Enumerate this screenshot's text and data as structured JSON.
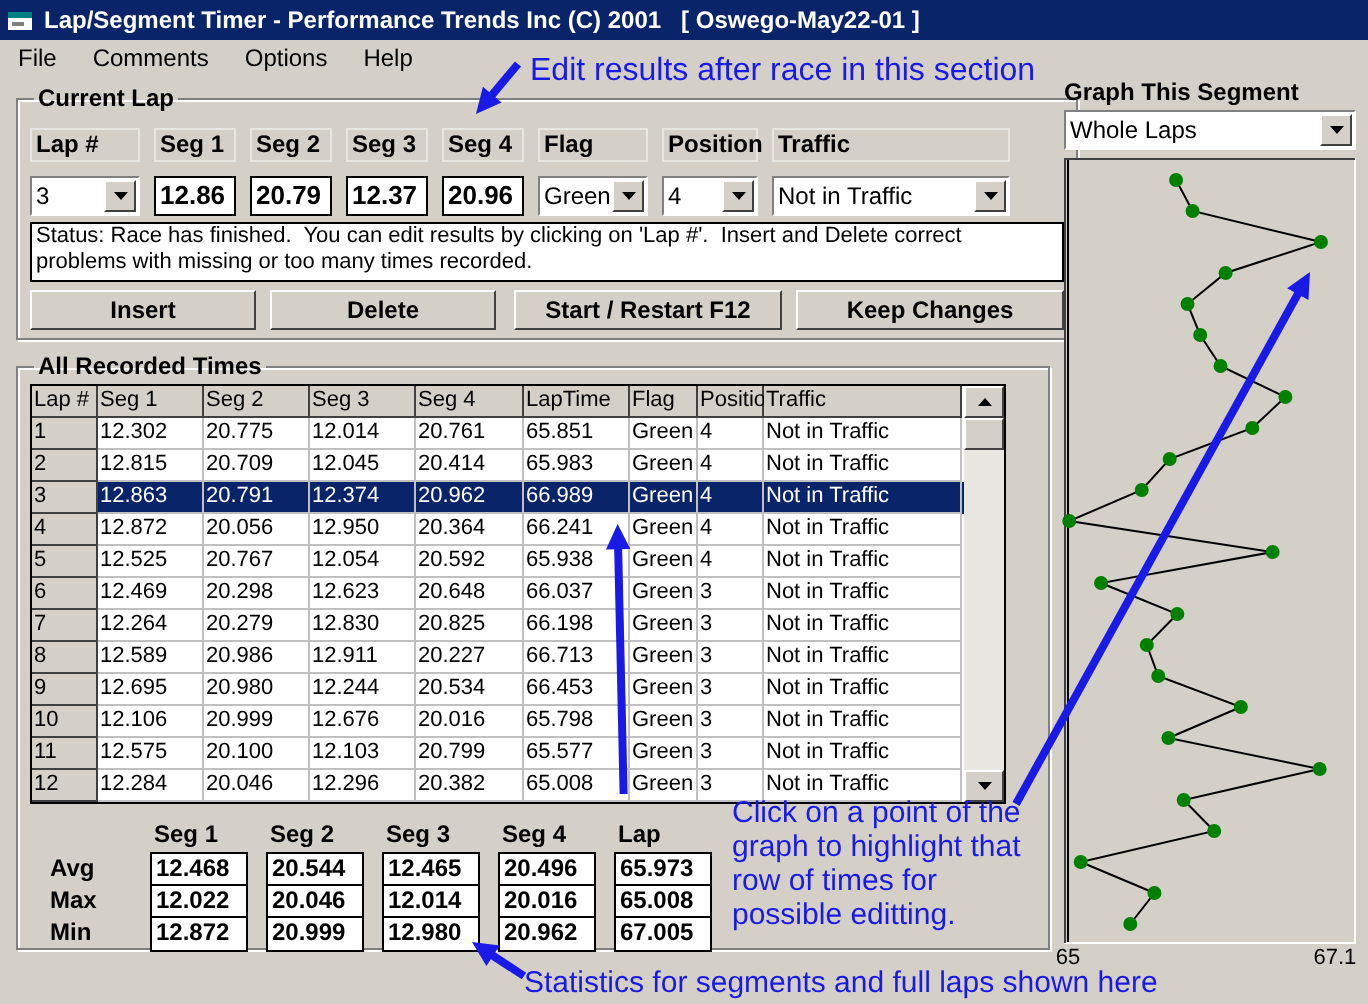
{
  "window": {
    "title": "Lap/Segment Timer - Performance Trends Inc (C) 2001   [ Oswego-May22-01 ]"
  },
  "menu": [
    "File",
    "Comments",
    "Options",
    "Help"
  ],
  "current_lap": {
    "title": "Current Lap",
    "fields": [
      {
        "kind": "dropdown",
        "label": "Lap #",
        "value": "3"
      },
      {
        "kind": "text",
        "label": "Seg 1",
        "value": "12.86"
      },
      {
        "kind": "text",
        "label": "Seg 2",
        "value": "20.79"
      },
      {
        "kind": "text",
        "label": "Seg 3",
        "value": "12.37"
      },
      {
        "kind": "text",
        "label": "Seg 4",
        "value": "20.96"
      },
      {
        "kind": "dropdown",
        "label": "Flag",
        "value": "Green"
      },
      {
        "kind": "dropdown",
        "label": "Position",
        "value": "4"
      },
      {
        "kind": "dropdown",
        "label": "Traffic",
        "value": "Not in Traffic"
      }
    ],
    "status": "Status: Race has finished.  You can edit results by clicking on 'Lap #'.  Insert and Delete correct problems with missing or too many times recorded.",
    "buttons": [
      "Insert",
      "Delete",
      "Start / Restart F12",
      "Keep Changes"
    ]
  },
  "recorded": {
    "title": "All Recorded Times",
    "columns": [
      "Lap #",
      "Seg 1",
      "Seg 2",
      "Seg 3",
      "Seg 4",
      "LapTime",
      "Flag",
      "Positio",
      "Traffic"
    ],
    "rows": [
      {
        "selected": false,
        "cells": [
          "1",
          "12.302",
          "20.775",
          "12.014",
          "20.761",
          "65.851",
          "Green",
          "4",
          "Not in Traffic"
        ]
      },
      {
        "selected": false,
        "cells": [
          "2",
          "12.815",
          "20.709",
          "12.045",
          "20.414",
          "65.983",
          "Green",
          "4",
          "Not in Traffic"
        ]
      },
      {
        "selected": true,
        "cells": [
          "3",
          "12.863",
          "20.791",
          "12.374",
          "20.962",
          "66.989",
          "Green",
          "4",
          "Not in Traffic"
        ]
      },
      {
        "selected": false,
        "cells": [
          "4",
          "12.872",
          "20.056",
          "12.950",
          "20.364",
          "66.241",
          "Green",
          "4",
          "Not in Traffic"
        ]
      },
      {
        "selected": false,
        "cells": [
          "5",
          "12.525",
          "20.767",
          "12.054",
          "20.592",
          "65.938",
          "Green",
          "4",
          "Not in Traffic"
        ]
      },
      {
        "selected": false,
        "cells": [
          "6",
          "12.469",
          "20.298",
          "12.623",
          "20.648",
          "66.037",
          "Green",
          "3",
          "Not in Traffic"
        ]
      },
      {
        "selected": false,
        "cells": [
          "7",
          "12.264",
          "20.279",
          "12.830",
          "20.825",
          "66.198",
          "Green",
          "3",
          "Not in Traffic"
        ]
      },
      {
        "selected": false,
        "cells": [
          "8",
          "12.589",
          "20.986",
          "12.911",
          "20.227",
          "66.713",
          "Green",
          "3",
          "Not in Traffic"
        ]
      },
      {
        "selected": false,
        "cells": [
          "9",
          "12.695",
          "20.980",
          "12.244",
          "20.534",
          "66.453",
          "Green",
          "3",
          "Not in Traffic"
        ]
      },
      {
        "selected": false,
        "cells": [
          "10",
          "12.106",
          "20.999",
          "12.676",
          "20.016",
          "65.798",
          "Green",
          "3",
          "Not in Traffic"
        ]
      },
      {
        "selected": false,
        "cells": [
          "11",
          "12.575",
          "20.100",
          "12.103",
          "20.799",
          "65.577",
          "Green",
          "3",
          "Not in Traffic"
        ]
      },
      {
        "selected": false,
        "cells": [
          "12",
          "12.284",
          "20.046",
          "12.296",
          "20.382",
          "65.008",
          "Green",
          "3",
          "Not in Traffic"
        ]
      }
    ]
  },
  "stats": {
    "columns": [
      "Seg 1",
      "Seg 2",
      "Seg 3",
      "Seg 4",
      "Lap"
    ],
    "rows": [
      {
        "label": "Avg",
        "values": [
          "12.468",
          "20.544",
          "12.465",
          "20.496",
          "65.973"
        ]
      },
      {
        "label": "Max",
        "values": [
          "12.022",
          "20.046",
          "12.014",
          "20.016",
          "65.008"
        ]
      },
      {
        "label": "Min",
        "values": [
          "12.872",
          "20.999",
          "12.980",
          "20.962",
          "67.005"
        ]
      }
    ]
  },
  "graph": {
    "title": "Graph This Segment",
    "selection": "Whole Laps",
    "chart_data": {
      "type": "line",
      "orientation": "horizontal",
      "marker": true,
      "values": [
        65.85,
        65.98,
        66.99,
        66.24,
        65.94,
        66.04,
        66.2,
        66.71,
        66.45,
        65.8,
        65.58,
        65.01,
        66.61,
        65.26,
        65.86,
        65.62,
        65.71,
        66.36,
        65.79,
        66.98,
        65.91,
        66.15,
        65.1,
        65.68,
        65.49
      ],
      "xlim": [
        65,
        67.25
      ],
      "xticks": [
        65,
        67.1
      ]
    }
  },
  "annotations": [
    {
      "kind": "edit",
      "text": "Edit results after race in this section"
    },
    {
      "kind": "graph",
      "text": "Click on a point of the graph to highlight that row of times for possible editting."
    },
    {
      "kind": "stats",
      "text": "Statistics for segments and full laps shown here"
    }
  ]
}
